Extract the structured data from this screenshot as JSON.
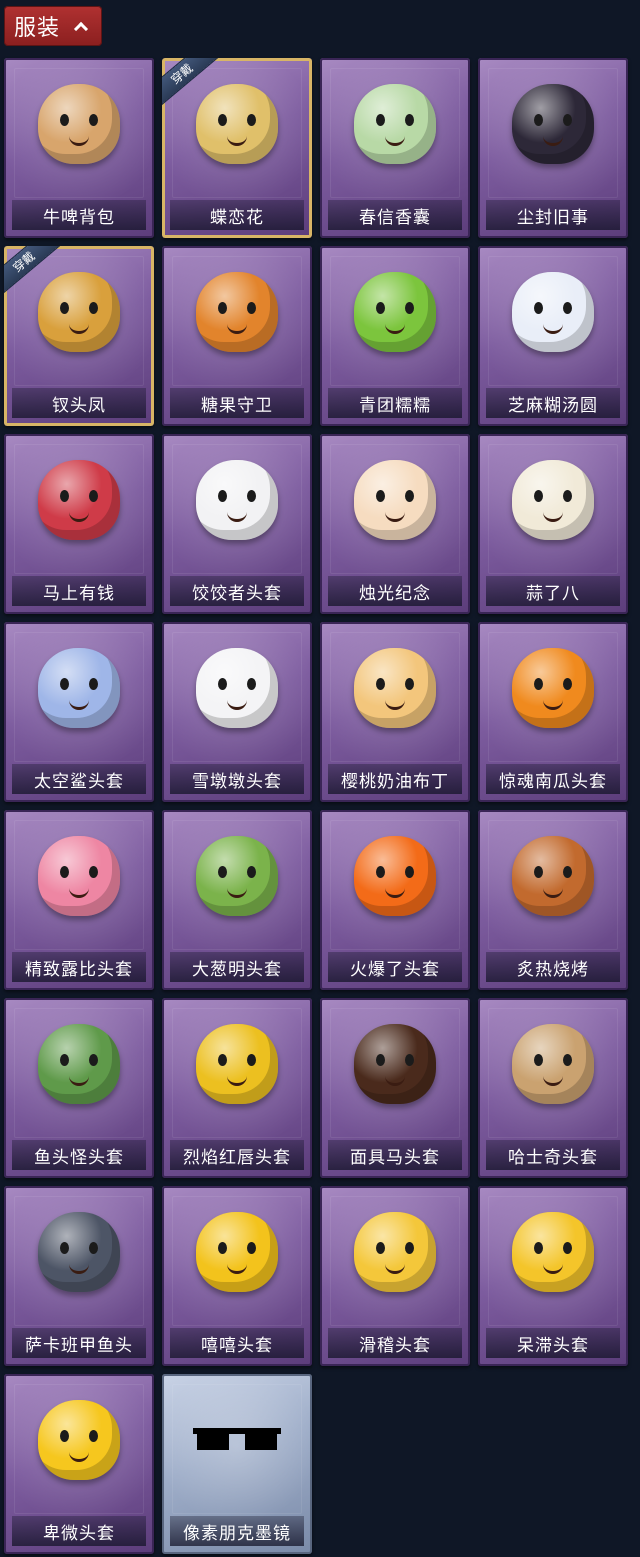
{
  "header": {
    "title": "服装"
  },
  "badge_text": "穿戴",
  "items": [
    {
      "label": "牛啤背包",
      "color": "#d8a56c",
      "icon": "beer-barrel-backpack-icon"
    },
    {
      "label": "蝶恋花",
      "color": "#e0c06a",
      "icon": "butterfly-bell-ornament-icon",
      "equipped": true
    },
    {
      "label": "春信香囊",
      "color": "#b8d9a6",
      "icon": "sachet-icon"
    },
    {
      "label": "尘封旧事",
      "color": "#2d2838",
      "icon": "chibi-doll-charm-icon"
    },
    {
      "label": "钗头凤",
      "color": "#d9a03c",
      "icon": "phoenix-crown-doll-icon",
      "equipped": true
    },
    {
      "label": "糖果守卫",
      "color": "#e2842c",
      "icon": "pumpkin-candy-guard-icon"
    },
    {
      "label": "青团糯糯",
      "color": "#7cc53d",
      "icon": "green-dumpling-icon"
    },
    {
      "label": "芝麻糊汤圆",
      "color": "#e9eef8",
      "icon": "rice-ball-icon"
    },
    {
      "label": "马上有钱",
      "color": "#cf3b48",
      "icon": "horse-head-icon"
    },
    {
      "label": "饺饺者头套",
      "color": "#f2f2f4",
      "icon": "dumpling-head-icon"
    },
    {
      "label": "烛光纪念",
      "color": "#f6dcc0",
      "icon": "candle-head-icon"
    },
    {
      "label": "蒜了八",
      "color": "#f1ead8",
      "icon": "garlic-head-icon"
    },
    {
      "label": "太空鲨头套",
      "color": "#9fb6e8",
      "icon": "shark-head-icon"
    },
    {
      "label": "雪墩墩头套",
      "color": "#f4f4f6",
      "icon": "snowman-head-icon"
    },
    {
      "label": "樱桃奶油布丁",
      "color": "#f3c67c",
      "icon": "pudding-head-icon"
    },
    {
      "label": "惊魂南瓜头套",
      "color": "#f08a1e",
      "icon": "pumpkin-head-icon"
    },
    {
      "label": "精致露比头套",
      "color": "#ee86a3",
      "icon": "pink-beaver-head-icon"
    },
    {
      "label": "大葱明头套",
      "color": "#7bb34b",
      "icon": "scallion-head-icon"
    },
    {
      "label": "火爆了头套",
      "color": "#f36b18",
      "icon": "fire-head-icon"
    },
    {
      "label": "炙热烧烤",
      "color": "#c26a2e",
      "icon": "grilled-meat-head-icon"
    },
    {
      "label": "鱼头怪头套",
      "color": "#5f9a4a",
      "icon": "fish-head-mask-icon"
    },
    {
      "label": "烈焰红唇头套",
      "color": "#ecc020",
      "icon": "yellow-mascot-sunglasses-icon"
    },
    {
      "label": "面具马头套",
      "color": "#4a2a1c",
      "icon": "horse-mask-icon"
    },
    {
      "label": "哈士奇头套",
      "color": "#caa270",
      "icon": "husky-sunglasses-icon"
    },
    {
      "label": "萨卡班甲鱼头",
      "color": "#4d5566",
      "icon": "fish-head-icon"
    },
    {
      "label": "嘻嘻头套",
      "color": "#f3c31c",
      "icon": "grin-emoji-head-icon"
    },
    {
      "label": "滑稽头套",
      "color": "#f4c73a",
      "icon": "smirk-emoji-head-icon"
    },
    {
      "label": "呆滞头套",
      "color": "#f4c52a",
      "icon": "stunned-emoji-head-icon"
    },
    {
      "label": "卑微头套",
      "color": "#f6c71e",
      "icon": "humble-emoji-head-icon"
    },
    {
      "label": "像素朋克墨镜",
      "color": "#000000",
      "icon": "pixel-sunglasses-icon",
      "special": true
    }
  ]
}
